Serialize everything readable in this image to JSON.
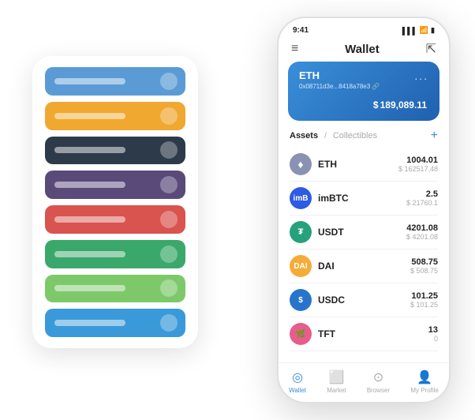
{
  "scene": {
    "back_panel": {
      "cards": [
        {
          "id": "card-1",
          "color_class": "card-blue"
        },
        {
          "id": "card-2",
          "color_class": "card-orange"
        },
        {
          "id": "card-3",
          "color_class": "card-dark"
        },
        {
          "id": "card-4",
          "color_class": "card-purple"
        },
        {
          "id": "card-5",
          "color_class": "card-red"
        },
        {
          "id": "card-6",
          "color_class": "card-green-dark"
        },
        {
          "id": "card-7",
          "color_class": "card-green-light"
        },
        {
          "id": "card-8",
          "color_class": "card-blue-bright"
        }
      ]
    },
    "phone": {
      "status_bar": {
        "time": "9:41",
        "signal": "▌▌▌",
        "wifi": "WiFi",
        "battery": "🔋"
      },
      "nav": {
        "menu_icon": "≡",
        "title": "Wallet",
        "expand_icon": "⇱"
      },
      "eth_card": {
        "title": "ETH",
        "address": "0x08711d3e...8418a78e3 🔗",
        "currency": "$",
        "amount": "189,089.11",
        "dots": "..."
      },
      "assets": {
        "tab_active": "Assets",
        "separator": "/",
        "tab_inactive": "Collectibles",
        "add_icon": "+"
      },
      "asset_list": [
        {
          "icon": "♦",
          "icon_class": "icon-eth",
          "name": "ETH",
          "amount_primary": "1004.01",
          "amount_secondary": "$ 162517.48"
        },
        {
          "icon": "B",
          "icon_class": "icon-imbtc",
          "name": "imBTC",
          "amount_primary": "2.5",
          "amount_secondary": "$ 21760.1"
        },
        {
          "icon": "₮",
          "icon_class": "icon-usdt",
          "name": "USDT",
          "amount_primary": "4201.08",
          "amount_secondary": "$ 4201.08"
        },
        {
          "icon": "◈",
          "icon_class": "icon-dai",
          "name": "DAI",
          "amount_primary": "508.75",
          "amount_secondary": "$ 508.75"
        },
        {
          "icon": "$",
          "icon_class": "icon-usdc",
          "name": "USDC",
          "amount_primary": "101.25",
          "amount_secondary": "$ 101.25"
        },
        {
          "icon": "🌿",
          "icon_class": "icon-tft",
          "name": "TFT",
          "amount_primary": "13",
          "amount_secondary": "0"
        }
      ],
      "bottom_nav": [
        {
          "label": "Wallet",
          "icon": "◎",
          "active": true
        },
        {
          "label": "Market",
          "icon": "📊",
          "active": false
        },
        {
          "label": "Browser",
          "icon": "👤",
          "active": false
        },
        {
          "label": "My Profile",
          "icon": "👤",
          "active": false
        }
      ]
    }
  }
}
